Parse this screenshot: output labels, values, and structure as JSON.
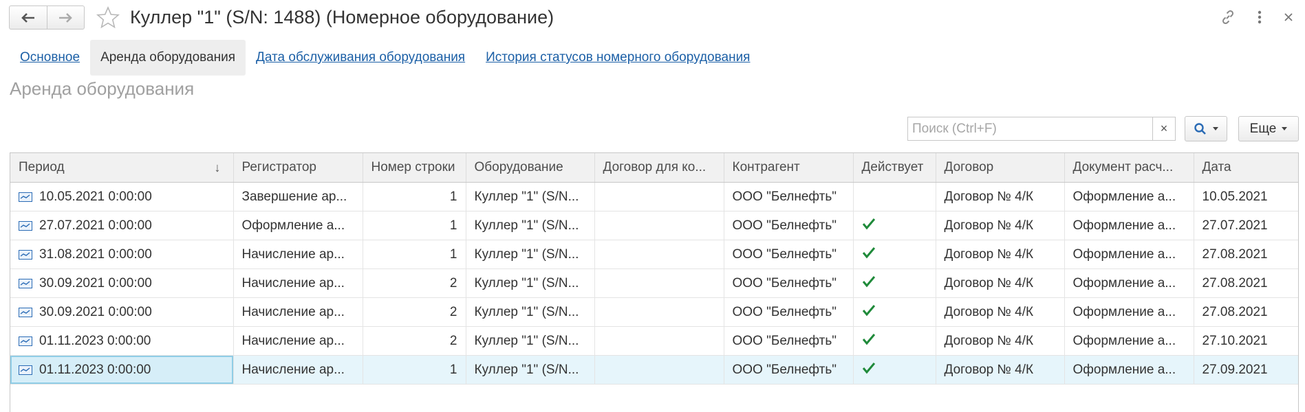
{
  "window": {
    "title": "Куллер \"1\" (S/N: 1488) (Номерное оборудование)"
  },
  "tabs": [
    {
      "label": "Основное"
    },
    {
      "label": "Аренда оборудования"
    },
    {
      "label": "Дата обслуживания оборудования"
    },
    {
      "label": "История статусов номерного оборудования"
    }
  ],
  "section_title": "Аренда оборудования",
  "search": {
    "placeholder": "Поиск (Ctrl+F)",
    "value": "",
    "clear_label": "×"
  },
  "toolbar": {
    "more_label": "Еще"
  },
  "table": {
    "columns": [
      "Период",
      "Регистратор",
      "Номер строки",
      "Оборудование",
      "Договор для ко...",
      "Контрагент",
      "Действует",
      "Договор",
      "Документ расч...",
      "Дата"
    ],
    "rows": [
      {
        "period": "10.05.2021 0:00:00",
        "registrator": "Завершение ар...",
        "line": "1",
        "equipment": "Куллер \"1\" (S/N...",
        "contract_for": "",
        "counterparty": "ООО \"Белнефть\"",
        "active": false,
        "contract": "Договор № 4/К",
        "document": "Оформление а...",
        "date": "10.05.2021"
      },
      {
        "period": "27.07.2021 0:00:00",
        "registrator": "Оформление а...",
        "line": "1",
        "equipment": "Куллер \"1\" (S/N...",
        "contract_for": "",
        "counterparty": "ООО \"Белнефть\"",
        "active": true,
        "contract": "Договор № 4/К",
        "document": "Оформление а...",
        "date": "27.07.2021"
      },
      {
        "period": "31.08.2021 0:00:00",
        "registrator": "Начисление ар...",
        "line": "1",
        "equipment": "Куллер \"1\" (S/N...",
        "contract_for": "",
        "counterparty": "ООО \"Белнефть\"",
        "active": true,
        "contract": "Договор № 4/К",
        "document": "Оформление а...",
        "date": "27.08.2021"
      },
      {
        "period": "30.09.2021 0:00:00",
        "registrator": "Начисление ар...",
        "line": "2",
        "equipment": "Куллер \"1\" (S/N...",
        "contract_for": "",
        "counterparty": "ООО \"Белнефть\"",
        "active": true,
        "contract": "Договор № 4/К",
        "document": "Оформление а...",
        "date": "27.08.2021"
      },
      {
        "period": "30.09.2021 0:00:00",
        "registrator": "Начисление ар...",
        "line": "2",
        "equipment": "Куллер \"1\" (S/N...",
        "contract_for": "",
        "counterparty": "ООО \"Белнефть\"",
        "active": true,
        "contract": "Договор № 4/К",
        "document": "Оформление а...",
        "date": "27.08.2021"
      },
      {
        "period": "01.11.2023 0:00:00",
        "registrator": "Начисление ар...",
        "line": "2",
        "equipment": "Куллер \"1\" (S/N...",
        "contract_for": "",
        "counterparty": "ООО \"Белнефть\"",
        "active": true,
        "contract": "Договор № 4/К",
        "document": "Оформление а...",
        "date": "27.10.2021"
      },
      {
        "period": "01.11.2023 0:00:00",
        "registrator": "Начисление ар...",
        "line": "1",
        "equipment": "Куллер \"1\" (S/N...",
        "contract_for": "",
        "counterparty": "ООО \"Белнефть\"",
        "active": true,
        "contract": "Договор № 4/К",
        "document": "Оформление а...",
        "date": "27.09.2021",
        "selected": true
      }
    ]
  },
  "icons": {
    "back": "arrow-left-icon",
    "forward": "arrow-right-icon",
    "favorite": "star-icon",
    "link": "link-icon",
    "menu": "more-vertical-icon",
    "close": "close-icon",
    "search": "search-icon",
    "row": "register-record-icon",
    "active": "checkmark-icon"
  },
  "colors": {
    "link": "#1b5fa6",
    "check": "#1f8a3a",
    "selection": "#e6f5fb",
    "search_icon": "#2a6bb5"
  }
}
